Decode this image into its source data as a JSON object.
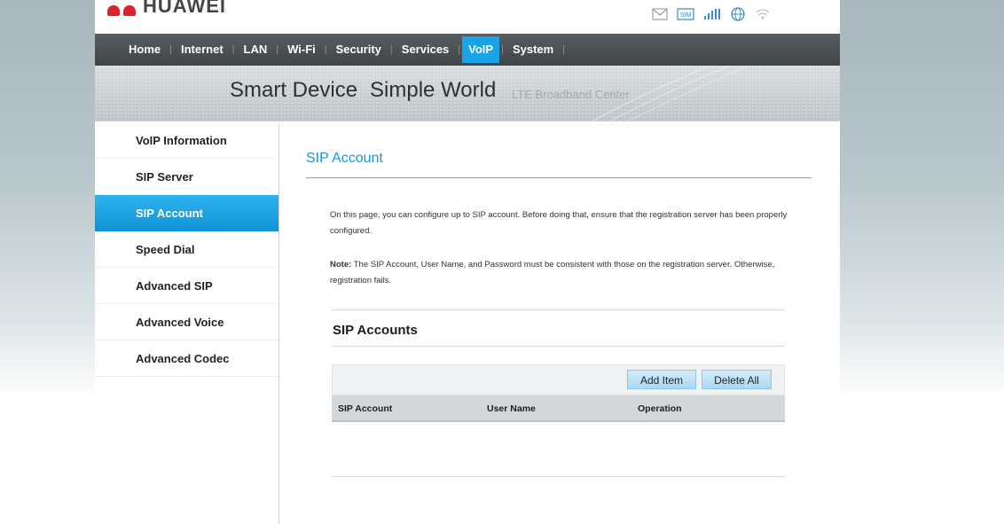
{
  "header": {
    "brand": "HUAWEI",
    "status_icons": [
      "mail-icon",
      "sim-icon",
      "signal-icon",
      "globe-icon",
      "wifi-icon"
    ],
    "sim_label": "SIM"
  },
  "nav": {
    "items": [
      {
        "label": "Home"
      },
      {
        "label": "Internet"
      },
      {
        "label": "LAN"
      },
      {
        "label": "Wi-Fi"
      },
      {
        "label": "Security"
      },
      {
        "label": "Services"
      },
      {
        "label": "VoIP"
      },
      {
        "label": "System"
      }
    ],
    "active": "VoIP"
  },
  "banner": {
    "slogan_part1": "Smart Device",
    "slogan_part2": "Simple World",
    "subtitle": "LTE Broadband Center"
  },
  "sidebar": {
    "items": [
      {
        "label": "VoIP Information"
      },
      {
        "label": "SIP Server"
      },
      {
        "label": "SIP Account"
      },
      {
        "label": "Speed Dial"
      },
      {
        "label": "Advanced SIP"
      },
      {
        "label": "Advanced Voice"
      },
      {
        "label": "Advanced Codec"
      }
    ],
    "active": "SIP Account"
  },
  "main": {
    "title": "SIP Account",
    "description": "On this page, you can configure up to SIP account. Before doing that, ensure that the registration server has been properly configured.",
    "note_label": "Note:",
    "note_text": " The SIP Account, User Name, and Password must be consistent with those on the registration server. Otherwise, registration fails.",
    "section_title": "SIP Accounts",
    "add_button": "Add Item",
    "delete_button": "Delete All",
    "columns": [
      "SIP Account",
      "User Name",
      "Operation"
    ]
  },
  "colors": {
    "accent": "#1aa4e6",
    "nav_bg": "#474c50",
    "brand_red": "#d8232a"
  }
}
